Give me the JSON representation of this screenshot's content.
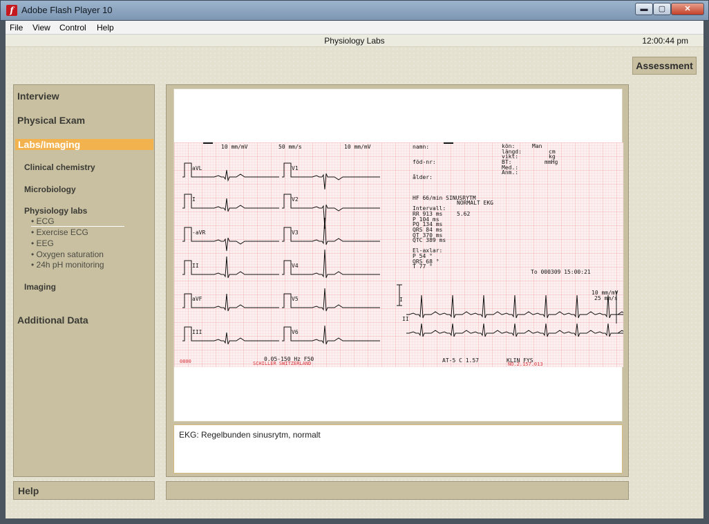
{
  "window": {
    "title": "Adobe Flash Player 10",
    "minimize": "▬",
    "maximize": "▢",
    "close": "✕"
  },
  "menu": [
    "File",
    "View",
    "Control",
    "Help"
  ],
  "header": {
    "title": "Physiology Labs",
    "time": "12:00:44 pm"
  },
  "assessment_label": "Assessment",
  "nav": {
    "interview": "Interview",
    "physical_exam": "Physical Exam",
    "labs_imaging": "Labs/Imaging",
    "clinical_chemistry": "Clinical chemistry",
    "microbiology": "Microbiology",
    "physiology_labs": "Physiology labs",
    "leaves": [
      "• ECG",
      "• Exercise ECG",
      "• EEG",
      "• Oxygen saturation",
      "• 24h pH monitoring"
    ],
    "imaging": "Imaging",
    "additional_data": "Additional Data"
  },
  "help_label": "Help",
  "caption": "EKG: Regelbunden sinusrytm, normalt",
  "ecg": {
    "header_left": "10 mm/mV",
    "header_mid": "50 mm/s",
    "header_right": "10 mm/mV",
    "leads_left": [
      "aVL",
      "I",
      "-aVR",
      "II",
      "aVF",
      "III"
    ],
    "leads_right": [
      "V1",
      "V2",
      "V3",
      "V4",
      "V5",
      "V6"
    ],
    "patient_labels": [
      "namn:",
      "föd-nr:",
      "ålder:"
    ],
    "sex_label": "kön:",
    "sex_value": "Man",
    "body_labels": [
      "längd:",
      "vikt:",
      "BT:",
      "Med.:",
      "Anm.:"
    ],
    "body_units": [
      "cm",
      "kg",
      "mmHg"
    ],
    "rhythm_line": "HF    66/min   SINUSRYTM",
    "rhythm_line2": "NORMALT EKG",
    "intervals_title": "Intervall:",
    "intervals": [
      "RR  913 ms",
      "P   104 ms",
      "PQ  134 ms",
      "QRS  84 ms",
      "QT  370 ms",
      "QTC 389 ms"
    ],
    "extra_value": "5.62",
    "axes_title": "El-axlar:",
    "axes": [
      "P     54 °",
      "QRS   68 °",
      "T     77 °"
    ],
    "timestamp": "To  000309  15:00:21",
    "rhythm_scale_1": "10 mm/mV",
    "rhythm_scale_2": "25 mm/s",
    "rhythm_lead_1": "I",
    "rhythm_lead_2": "II",
    "footer_filter": "0.05-150 Hz  F50",
    "footer_brand": "SCHILLER SWITZERLAND",
    "footer_id": "AT-5    C 1.57",
    "footer_lab": "KLIN FYS",
    "footer_code": "NO.2.157.013",
    "footer_small": "0800"
  }
}
